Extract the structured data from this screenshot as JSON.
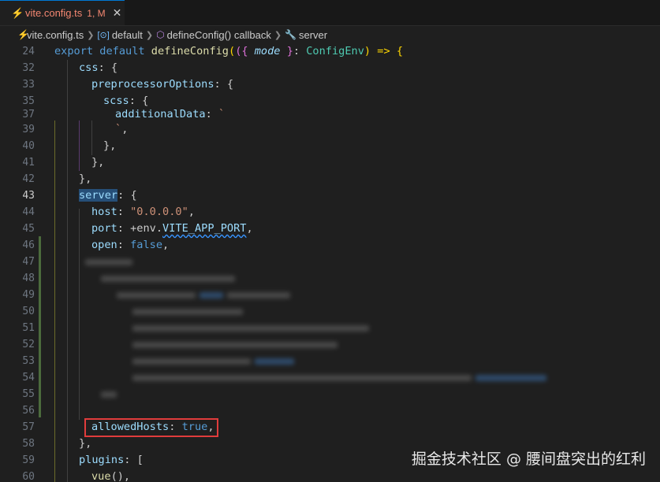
{
  "tab": {
    "filename": "vite.config.ts",
    "status": "1, M",
    "close": "✕"
  },
  "breadcrumb": {
    "file": "vite.config.ts",
    "items": [
      "default",
      "defineConfig() callback",
      "server"
    ]
  },
  "lines": [
    {
      "n": "24"
    },
    {
      "n": "32"
    },
    {
      "n": "33"
    },
    {
      "n": "35"
    },
    {
      "n": "37"
    },
    {
      "n": "39"
    },
    {
      "n": "40"
    },
    {
      "n": "41"
    },
    {
      "n": "42"
    },
    {
      "n": "43"
    },
    {
      "n": "44"
    },
    {
      "n": "45"
    },
    {
      "n": "46"
    },
    {
      "n": "47"
    },
    {
      "n": "48"
    },
    {
      "n": "49"
    },
    {
      "n": "50"
    },
    {
      "n": "51"
    },
    {
      "n": "52"
    },
    {
      "n": "53"
    },
    {
      "n": "54"
    },
    {
      "n": "55"
    },
    {
      "n": "56"
    },
    {
      "n": "57"
    },
    {
      "n": "58"
    },
    {
      "n": "59"
    },
    {
      "n": "60"
    }
  ],
  "code": {
    "l24": {
      "kw1": "export",
      "kw2": "default",
      "fn": "defineConfig",
      "p1": "(",
      "p2": "({",
      "param": "mode",
      "p3": "}",
      "colon": ": ",
      "type": "ConfigEnv",
      "p4": ") => {"
    },
    "l32": {
      "prop": "css",
      "rest": ": {"
    },
    "l33": {
      "prop": "preprocessorOptions",
      "rest": ": {"
    },
    "l35": {
      "prop": "scss",
      "rest": ": {"
    },
    "l37": {
      "prop": "additionalData",
      "rest": ": ",
      "str": "`"
    },
    "l39": {
      "str": "`",
      "rest": ","
    },
    "l40": {
      "rest": "},"
    },
    "l41": {
      "rest": "},"
    },
    "l42": {
      "rest": "},"
    },
    "l43": {
      "prop": "server",
      "rest": ": {"
    },
    "l44": {
      "prop": "host",
      "rest": ": ",
      "str": "\"0.0.0.0\"",
      "end": ","
    },
    "l45": {
      "prop": "port",
      "rest": ": +env.",
      "prop2": "VITE_APP_PORT",
      "end": ","
    },
    "l46": {
      "prop": "open",
      "rest": ": ",
      "kw": "false",
      "end": ","
    },
    "l57": {
      "prop": "allowedHosts",
      "rest": ": ",
      "kw": "true",
      "end": ","
    },
    "l58": {
      "rest": "},"
    },
    "l59": {
      "prop": "plugins",
      "rest": ": ["
    },
    "l60": {
      "fn": "vue",
      "rest": "(),"
    }
  },
  "watermark": "掘金技术社区 @ 腰间盘突出的红利",
  "colors": {
    "accent": "#0078d4",
    "modified": "#f48771",
    "highlight": "#e03c3c"
  }
}
